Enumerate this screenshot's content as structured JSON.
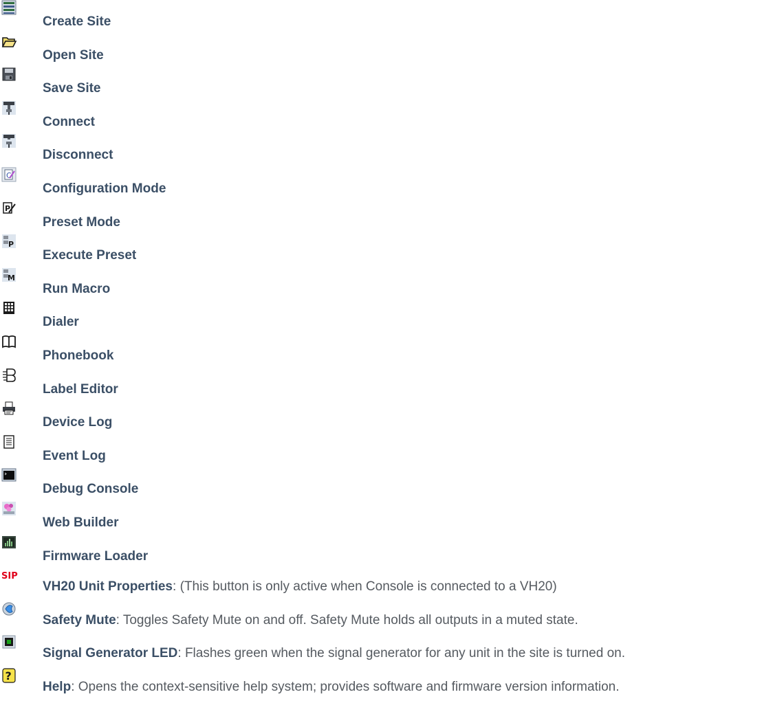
{
  "items": [
    {
      "icon": "create-site-icon",
      "label": "Create Site"
    },
    {
      "icon": "open-site-icon",
      "label": "Open Site"
    },
    {
      "icon": "save-site-icon",
      "label": "Save Site"
    },
    {
      "icon": "connect-icon",
      "label": "Connect"
    },
    {
      "icon": "disconnect-icon",
      "label": "Disconnect"
    },
    {
      "icon": "configuration-mode-icon",
      "label": "Configuration Mode"
    },
    {
      "icon": "preset-mode-icon",
      "label": "Preset Mode"
    },
    {
      "icon": "execute-preset-icon",
      "label": "Execute Preset"
    },
    {
      "icon": "run-macro-icon",
      "label": "Run Macro"
    },
    {
      "icon": "dialer-icon",
      "label": "Dialer"
    },
    {
      "icon": "phonebook-icon",
      "label": "Phonebook"
    },
    {
      "icon": "label-editor-icon",
      "label": "Label Editor"
    },
    {
      "icon": "device-log-icon",
      "label": "Device Log"
    },
    {
      "icon": "event-log-icon",
      "label": "Event Log"
    },
    {
      "icon": "debug-console-icon",
      "label": "Debug Console"
    },
    {
      "icon": "web-builder-icon",
      "label": "Web Builder"
    },
    {
      "icon": "firmware-loader-icon",
      "label": "Firmware Loader"
    },
    {
      "icon": "sip-icon",
      "icon_text": "SIP",
      "label": "VH20 Unit Properties",
      "separator": ": ",
      "desc": "(This button is only active when Console is connected to a VH20)"
    },
    {
      "icon": "safety-mute-icon",
      "label": "Safety Mute",
      "separator": ": ",
      "desc": "Toggles Safety Mute on and off. Safety Mute holds all outputs in a muted state."
    },
    {
      "icon": "signal-generator-led-icon",
      "label": "Signal Generator LED",
      "separator": ": ",
      "desc": "Flashes green when the signal generator for any unit in the site is turned on."
    },
    {
      "icon": "help-icon",
      "icon_text": "?",
      "label": "Help",
      "separator": ": ",
      "desc": "Opens the context-sensitive help system; provides software and firmware version information."
    }
  ],
  "colors": {
    "label": "#3b4f66",
    "body_text": "#555a60",
    "sip_red": "#e0001b",
    "led_green": "#1aa31a",
    "mute_blue": "#3a8ee6",
    "help_yellow": "#f6e24a"
  }
}
